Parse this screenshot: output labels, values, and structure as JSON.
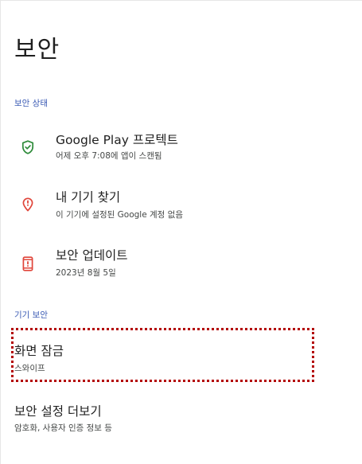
{
  "page": {
    "title": "보안"
  },
  "sections": {
    "security_status": {
      "label": "보안 상태"
    },
    "device_security": {
      "label": "기기 보안"
    }
  },
  "items": {
    "play_protect": {
      "title": "Google Play 프로텍트",
      "subtitle": "어제 오후 7:08에 앱이 스캔됨",
      "icon": "shield-check-icon",
      "icon_color": "#2e8b3a"
    },
    "find_device": {
      "title": "내 기기 찾기",
      "subtitle": "이 기기에 설정된 Google 계정 없음",
      "icon": "location-alert-icon",
      "icon_color": "#e0453a"
    },
    "security_update": {
      "title": "보안 업데이트",
      "subtitle": "2023년 8월 5일",
      "icon": "phone-alert-icon",
      "icon_color": "#e0453a"
    },
    "screen_lock": {
      "title": "화면 잠금",
      "subtitle": "스와이프"
    },
    "more_settings": {
      "title": "보안 설정 더보기",
      "subtitle": "암호화, 사용자 인증 정보 등"
    }
  },
  "colors": {
    "accent": "#3b5bb4",
    "ok": "#2e8b3a",
    "alert": "#e0453a",
    "highlight": "#b30000"
  }
}
